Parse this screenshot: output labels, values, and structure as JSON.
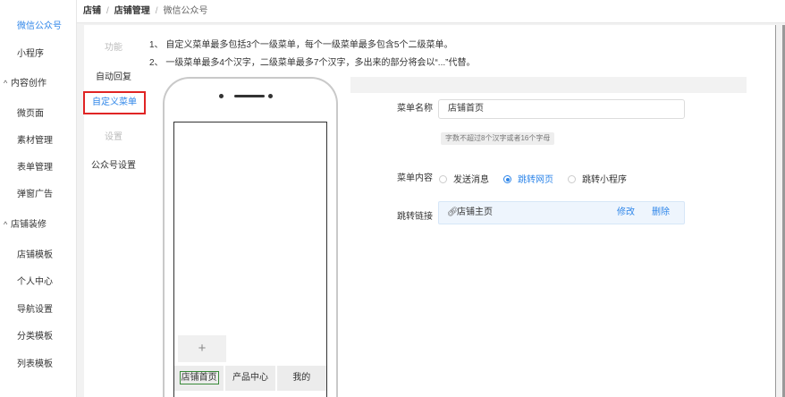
{
  "sidebar": {
    "items": [
      {
        "label": "微信公众号",
        "kind": "sub",
        "active": true
      },
      {
        "label": "小程序",
        "kind": "sub"
      },
      {
        "label": "内容创作",
        "kind": "group"
      },
      {
        "label": "微页面",
        "kind": "sub"
      },
      {
        "label": "素材管理",
        "kind": "sub"
      },
      {
        "label": "表单管理",
        "kind": "sub"
      },
      {
        "label": "弹窗广告",
        "kind": "sub"
      },
      {
        "label": "店铺装修",
        "kind": "group"
      },
      {
        "label": "店铺模板",
        "kind": "sub"
      },
      {
        "label": "个人中心",
        "kind": "sub"
      },
      {
        "label": "导航设置",
        "kind": "sub"
      },
      {
        "label": "分类模板",
        "kind": "sub"
      },
      {
        "label": "列表模板",
        "kind": "sub"
      }
    ],
    "caret": "^"
  },
  "breadcrumb": {
    "items": [
      "店铺",
      "店铺管理",
      "微信公众号"
    ],
    "separator": "/"
  },
  "subnav": {
    "items": [
      {
        "label": "功能",
        "state": "muted"
      },
      {
        "label": "自动回复",
        "state": "normal"
      },
      {
        "label": "自定义菜单",
        "state": "selected"
      },
      {
        "label": "设置",
        "state": "muted"
      },
      {
        "label": "公众号设置",
        "state": "normal"
      }
    ]
  },
  "notes": [
    "1、 自定义菜单最多包括3个一级菜单，每个一级菜单最多包含5个二级菜单。",
    "2、 一级菜单最多4个汉字，二级菜单最多7个汉字，多出来的部分将会以“...”代替。"
  ],
  "phone": {
    "add_label": "+",
    "menu_tabs": [
      {
        "label": "店铺首页",
        "active": true
      },
      {
        "label": "产品中心"
      },
      {
        "label": "我的"
      }
    ]
  },
  "form": {
    "name_label": "菜单名称",
    "name_value": "店铺首页",
    "name_hint": "字数不超过8个汉字或者16个字母",
    "content_label": "菜单内容",
    "content_options": [
      {
        "label": "发送消息",
        "selected": false
      },
      {
        "label": "跳转网页",
        "selected": true
      },
      {
        "label": "跳转小程序",
        "selected": false
      }
    ],
    "link_label": "跳转链接",
    "link_text": "店铺主页",
    "link_edit": "修改",
    "link_delete": "删除"
  },
  "colors": {
    "accent": "#2f86e9",
    "highlight_border": "#e02424"
  },
  "icons": {
    "link": "link-icon",
    "caret": "caret-up-icon"
  }
}
